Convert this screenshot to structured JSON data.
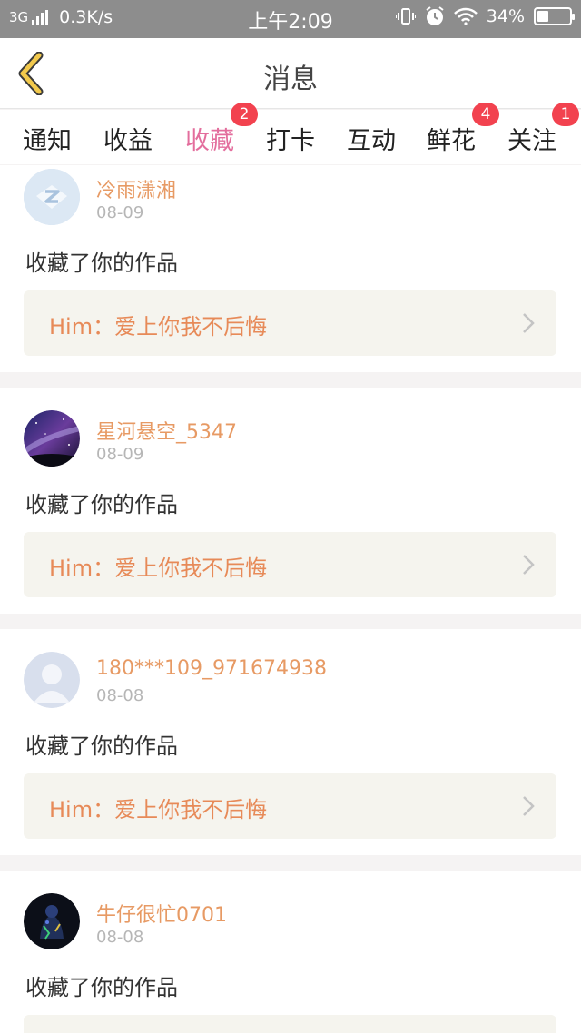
{
  "status_bar": {
    "network_type": "3G",
    "speed": "0.3K/s",
    "time": "上午2:09",
    "battery_percent": "34%",
    "battery_level": 0.34,
    "icons": [
      "signal-icon",
      "vibrate-icon",
      "alarm-icon",
      "wifi-icon",
      "battery-icon"
    ]
  },
  "header": {
    "title": "消息",
    "back_icon": "chevron-left-icon",
    "accent_color": "#f2c94c"
  },
  "tabs": [
    {
      "label": "通知",
      "badge": ""
    },
    {
      "label": "收益",
      "badge": ""
    },
    {
      "label": "收藏",
      "badge": "2",
      "active": true
    },
    {
      "label": "打卡",
      "badge": ""
    },
    {
      "label": "互动",
      "badge": ""
    },
    {
      "label": "鲜花",
      "badge": "4"
    },
    {
      "label": "关注",
      "badge": "1"
    }
  ],
  "colors": {
    "active_tab": "#e36e9d",
    "badge": "#f2424f",
    "username": "#e79a64",
    "work_link_text": "#e78a58"
  },
  "notifications": [
    {
      "username": "冷雨潇湘",
      "date": "08-09",
      "action": "收藏了你的作品",
      "work_link": "Him：爱上你我不后悔",
      "avatar": "default-z-avatar"
    },
    {
      "username": "星河悬空_5347",
      "date": "08-09",
      "action": "收藏了你的作品",
      "work_link": "Him：爱上你我不后悔",
      "avatar": "galaxy-avatar"
    },
    {
      "username": "180***109_971674938",
      "date": "08-08",
      "action": "收藏了你的作品",
      "work_link": "Him：爱上你我不后悔",
      "avatar": "default-person-avatar"
    },
    {
      "username": "牛仔很忙0701",
      "date": "08-08",
      "action": "收藏了你的作品",
      "work_link": "",
      "avatar": "dark-photo-avatar"
    }
  ]
}
